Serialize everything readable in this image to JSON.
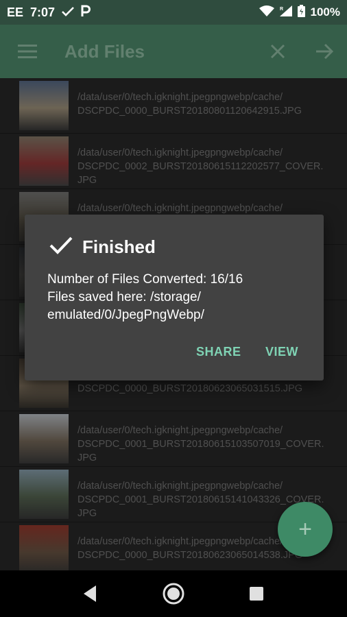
{
  "status_bar": {
    "carrier": "EE",
    "time": "7:07",
    "battery": "100%"
  },
  "toolbar": {
    "title": "Add Files"
  },
  "files": [
    {
      "path": "/data/user/0/tech.igknight.jpegpngwebp/cache/\nDSCPDC_0000_BURST20180801120642915.JPG",
      "thumb": [
        "#5b6f8e",
        "#a89a82",
        "#3b3b3b"
      ]
    },
    {
      "path": "/data/user/0/tech.igknight.jpegpngwebp/cache/\nDSCPDC_0002_BURST20180615112202577_COVER.\nJPG",
      "thumb": [
        "#8c7f6e",
        "#9a3b3b",
        "#4a4a4a"
      ]
    },
    {
      "path": "/data/user/0/tech.igknight.jpegpngwebp/cache/",
      "thumb": [
        "#7a7a78",
        "#5b5548",
        "#3c3a36"
      ]
    },
    {
      "path": "",
      "thumb": [
        "#2f3338",
        "#4b4a47",
        "#333"
      ]
    },
    {
      "path": "",
      "thumb": [
        "#3a4a3a",
        "#777",
        "#333"
      ]
    },
    {
      "path": "\nDSCPDC_0000_BURST20180623065031515.JPG",
      "thumb": [
        "#4a4036",
        "#8a7b66",
        "#3a3630"
      ]
    },
    {
      "path": "/data/user/0/tech.igknight.jpegpngwebp/cache/\nDSCPDC_0001_BURST20180615103507019_COVER.\nJPG",
      "thumb": [
        "#c3c9cf",
        "#7c6e5e",
        "#3f3f3f"
      ]
    },
    {
      "path": "/data/user/0/tech.igknight.jpegpngwebp/cache/\nDSCPDC_0001_BURST20180615141043326_COVER.\nJPG",
      "thumb": [
        "#8fa7b5",
        "#5a6a55",
        "#3c3c3c"
      ]
    },
    {
      "path": "/data/user/0/tech.igknight.jpegpngwebp/cache/\nDSCPDC_0000_BURST20180623065014538.JPG",
      "thumb": [
        "#9b3b2f",
        "#6e5846",
        "#3a3a3a"
      ]
    }
  ],
  "dialog": {
    "title": "Finished",
    "body_line1": "Number of Files Converted: 16/16",
    "body_line2": "Files saved here: /storage/\nemulated/0/JpegPngWebp/",
    "share_label": "SHARE",
    "view_label": "VIEW"
  },
  "fab": {
    "label": "+"
  },
  "colors": {
    "toolbar": "#355e49",
    "status_bar": "#2f4c3e",
    "accent": "#7fd3b4",
    "fab": "#3e8a66",
    "dialog": "#424242"
  }
}
